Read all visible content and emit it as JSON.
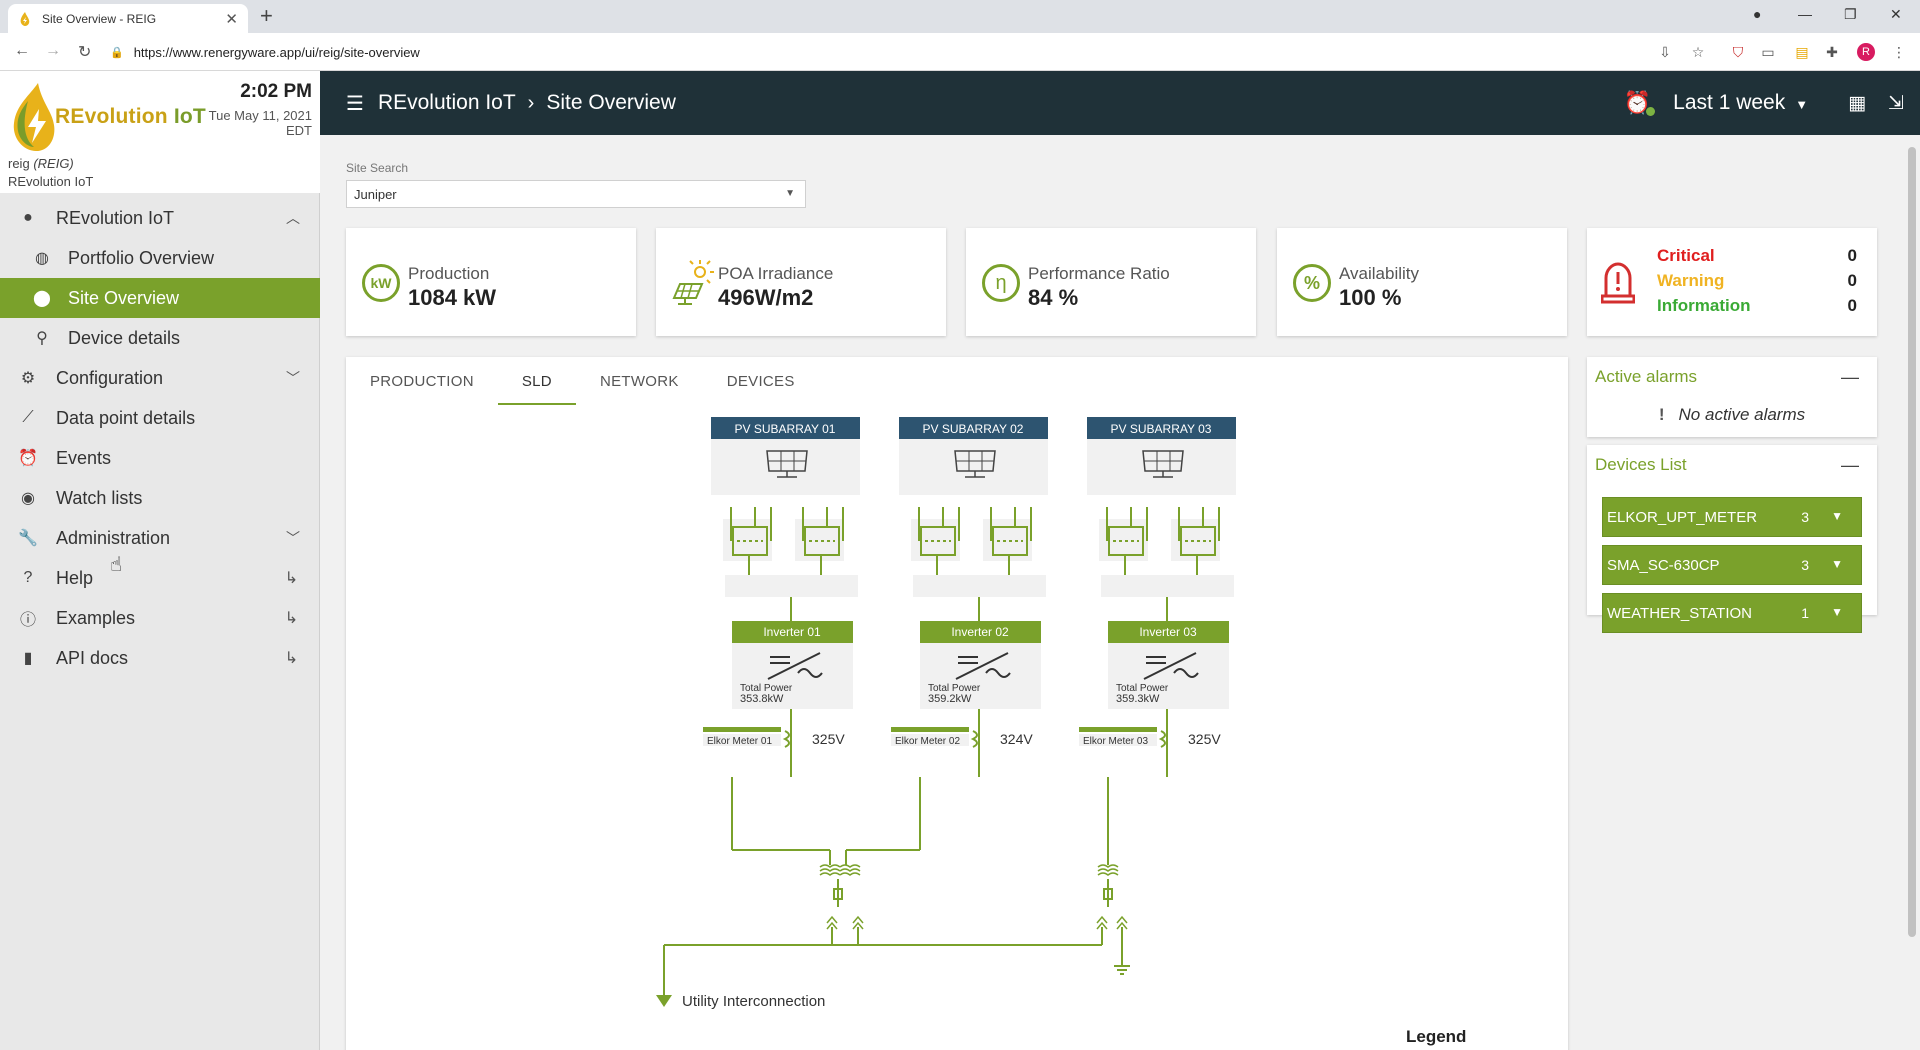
{
  "browser": {
    "tab_title": "Site Overview - REIG",
    "url": "https://www.renergyware.app/ui/reig/site-overview"
  },
  "header": {
    "menu_icon": "hamburger-icon",
    "crumb_root": "REvolution IoT",
    "crumb_sep": "›",
    "crumb_page": "Site Overview",
    "time_range": "Last 1 week"
  },
  "sidebar": {
    "logo_word1": "REvolution",
    "logo_word2": " IoT",
    "time": "2:02 PM",
    "date": "Tue May 11, 2021",
    "tz": "EDT",
    "user_name": "reig",
    "user_code": "(REIG)",
    "user_org": "REvolution IoT",
    "items": [
      {
        "label": "REvolution IoT",
        "icon": "circle-icon"
      },
      {
        "label": "Portfolio Overview",
        "icon": "globe-icon"
      },
      {
        "label": "Site Overview",
        "icon": "location-pin-icon"
      },
      {
        "label": "Device details",
        "icon": "search-icon"
      },
      {
        "label": "Configuration",
        "icon": "gear-icon"
      },
      {
        "label": "Data point details",
        "icon": "trend-icon"
      },
      {
        "label": "Events",
        "icon": "alarm-clock-icon"
      },
      {
        "label": "Watch lists",
        "icon": "eye-icon"
      },
      {
        "label": "Administration",
        "icon": "wrench-icon"
      },
      {
        "label": "Help",
        "icon": "help-icon"
      },
      {
        "label": "Examples",
        "icon": "info-icon"
      },
      {
        "label": "API docs",
        "icon": "book-icon"
      }
    ]
  },
  "search": {
    "label": "Site Search",
    "value": "Juniper"
  },
  "kpis": [
    {
      "label": "Production",
      "value": "1084 kW",
      "icon": "kW"
    },
    {
      "label": "POA Irradiance",
      "value": "496W/m2",
      "icon": "sun-panel-icon"
    },
    {
      "label": "Performance Ratio",
      "value": "84 %",
      "icon": "η"
    },
    {
      "label": "Availability",
      "value": "100 %",
      "icon": "%"
    }
  ],
  "alarm_summary": {
    "critical_label": "Critical",
    "critical_count": "0",
    "critical_color": "#e01f1f",
    "warning_label": "Warning",
    "warning_count": "0",
    "warning_color": "#f0b323",
    "info_label": "Information",
    "info_count": "0",
    "info_color": "#3aaa35"
  },
  "tabs": [
    "PRODUCTION",
    "SLD",
    "NETWORK",
    "DEVICES"
  ],
  "sld": {
    "subarrays": [
      "PV SUBARRAY 01",
      "PV SUBARRAY 02",
      "PV SUBARRAY 03"
    ],
    "inverters": [
      {
        "name": "Inverter 01",
        "power_label": "Total Power",
        "power": "353.8kW",
        "meter": "Elkor Meter 01",
        "voltage": "325V"
      },
      {
        "name": "Inverter 02",
        "power_label": "Total Power",
        "power": "359.2kW",
        "meter": "Elkor Meter 02",
        "voltage": "324V"
      },
      {
        "name": "Inverter 03",
        "power_label": "Total Power",
        "power": "359.3kW",
        "meter": "Elkor Meter 03",
        "voltage": "325V"
      }
    ],
    "utility": "Utility Interconnection"
  },
  "legend_title": "Legend",
  "active_alarms": {
    "title": "Active alarms",
    "empty": "No active alarms"
  },
  "devices": {
    "title": "Devices List",
    "items": [
      {
        "name": "ELKOR_UPT_METER",
        "count": "3"
      },
      {
        "name": "SMA_SC-630CP",
        "count": "3"
      },
      {
        "name": "WEATHER_STATION",
        "count": "1"
      }
    ]
  },
  "colors": {
    "accent": "#7aa12b",
    "header": "#1f3138",
    "subarray_header": "#2d5470"
  }
}
